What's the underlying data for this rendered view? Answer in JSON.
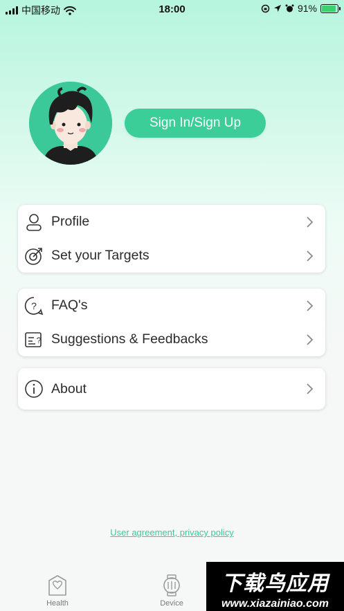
{
  "status_bar": {
    "carrier": "中国移动",
    "time": "18:00",
    "battery": "91%",
    "battery_level": 0.91
  },
  "profile_header": {
    "sign_in_label": "Sign In/Sign Up"
  },
  "menu_groups": [
    {
      "items": [
        {
          "label": "Profile",
          "icon": "user-icon"
        },
        {
          "label": "Set your Targets",
          "icon": "target-icon"
        }
      ]
    },
    {
      "items": [
        {
          "label": "FAQ's",
          "icon": "question-icon"
        },
        {
          "label": "Suggestions & Feedbacks",
          "icon": "feedback-icon"
        }
      ]
    },
    {
      "items": [
        {
          "label": "About",
          "icon": "info-icon"
        }
      ]
    }
  ],
  "footer": {
    "legal_link": "User agreement, privacy policy"
  },
  "tab_bar": {
    "tabs": [
      {
        "label": "Health",
        "icon": "heart-shield-icon"
      },
      {
        "label": "Device",
        "icon": "watch-icon"
      }
    ]
  },
  "watermark": {
    "title": "下载鸟应用",
    "url": "www.xiazainiao.com"
  },
  "colors": {
    "accent": "#3cce99",
    "background": "#f6f7f7",
    "header_gradient_top": "#b6f5de"
  }
}
